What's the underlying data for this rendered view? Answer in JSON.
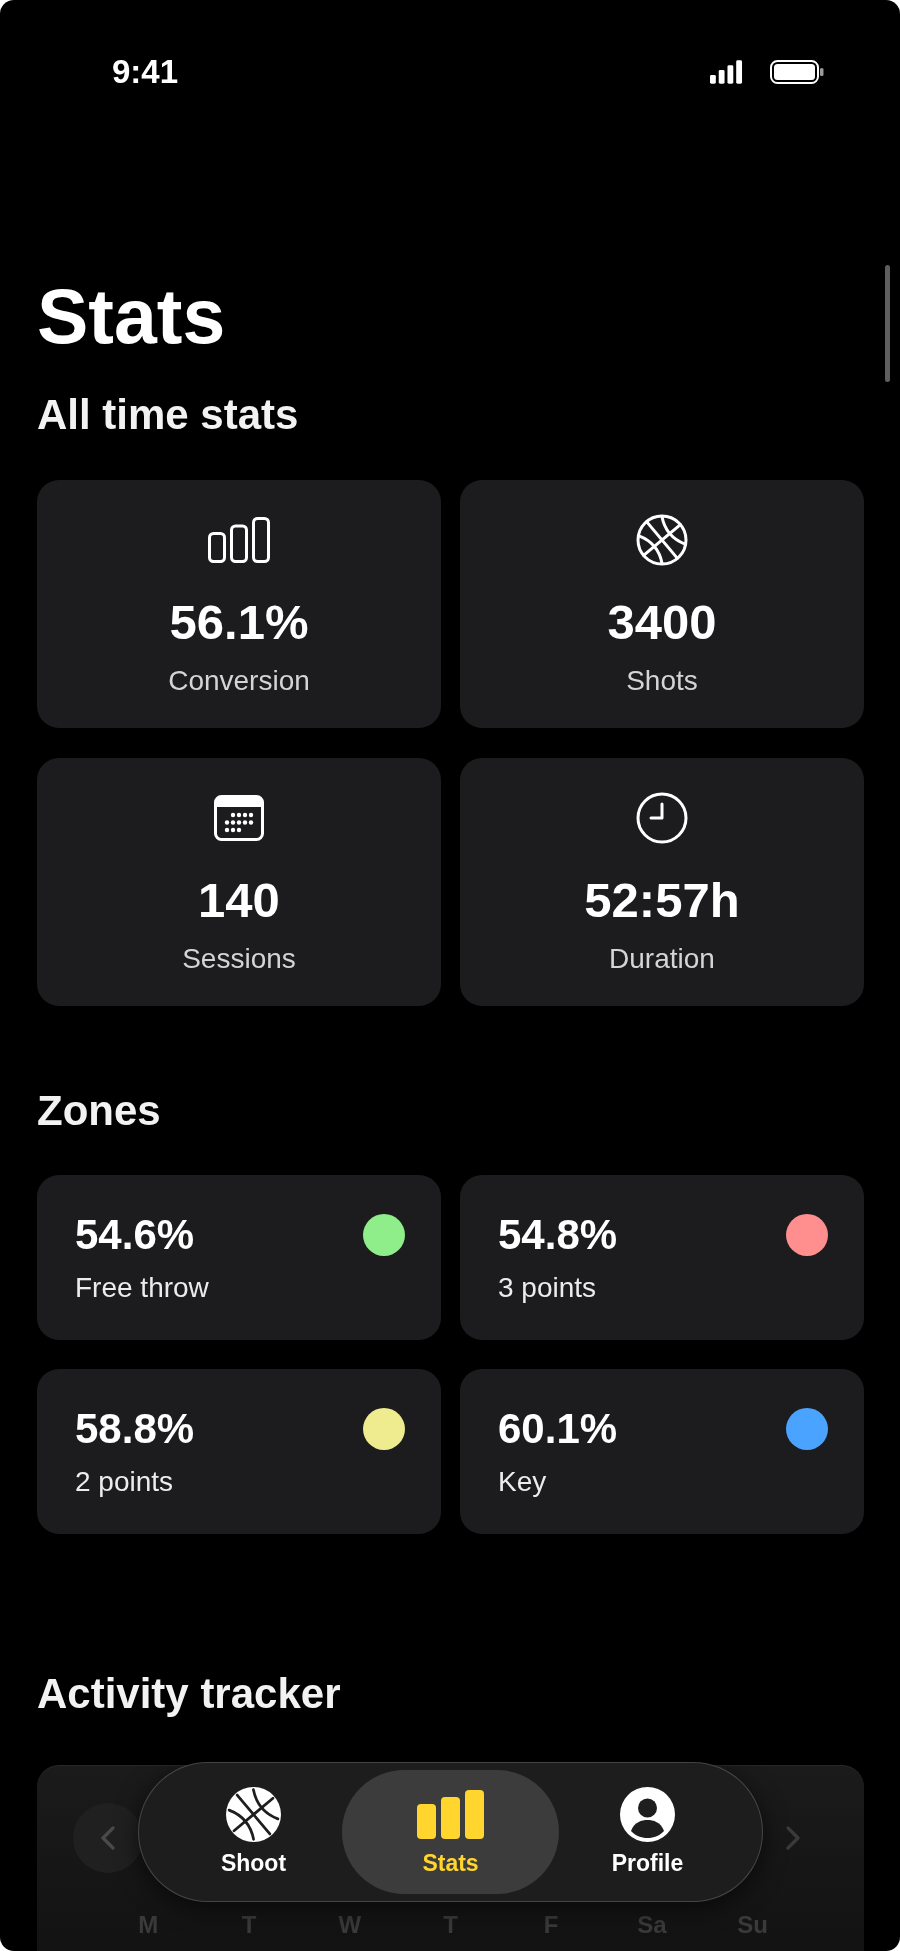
{
  "status_bar": {
    "time": "9:41"
  },
  "title": "Stats",
  "all_time_stats": {
    "heading": "All time stats",
    "cards": [
      {
        "value": "56.1%",
        "label": "Conversion"
      },
      {
        "value": "3400",
        "label": "Shots"
      },
      {
        "value": "140",
        "label": "Sessions"
      },
      {
        "value": "52:57h",
        "label": "Duration"
      }
    ]
  },
  "zones": {
    "heading": "Zones",
    "items": [
      {
        "value": "54.6%",
        "label": "Free throw",
        "color": "#8fee8a"
      },
      {
        "value": "54.8%",
        "label": "3 points",
        "color": "#ff8f8f"
      },
      {
        "value": "58.8%",
        "label": "2 points",
        "color": "#eeec8f"
      },
      {
        "value": "60.1%",
        "label": "Key",
        "color": "#4aa3ff"
      }
    ]
  },
  "activity_tracker": {
    "heading": "Activity tracker",
    "previous_button": {
      "disabled": false
    },
    "next_button": {
      "disabled": true
    },
    "weekdays": [
      "M",
      "T",
      "W",
      "T",
      "F",
      "Sa",
      "Su"
    ]
  },
  "tab_bar": {
    "tabs": [
      {
        "label": "Shoot",
        "selected": false
      },
      {
        "label": "Stats",
        "selected": true
      },
      {
        "label": "Profile",
        "selected": false
      }
    ]
  }
}
